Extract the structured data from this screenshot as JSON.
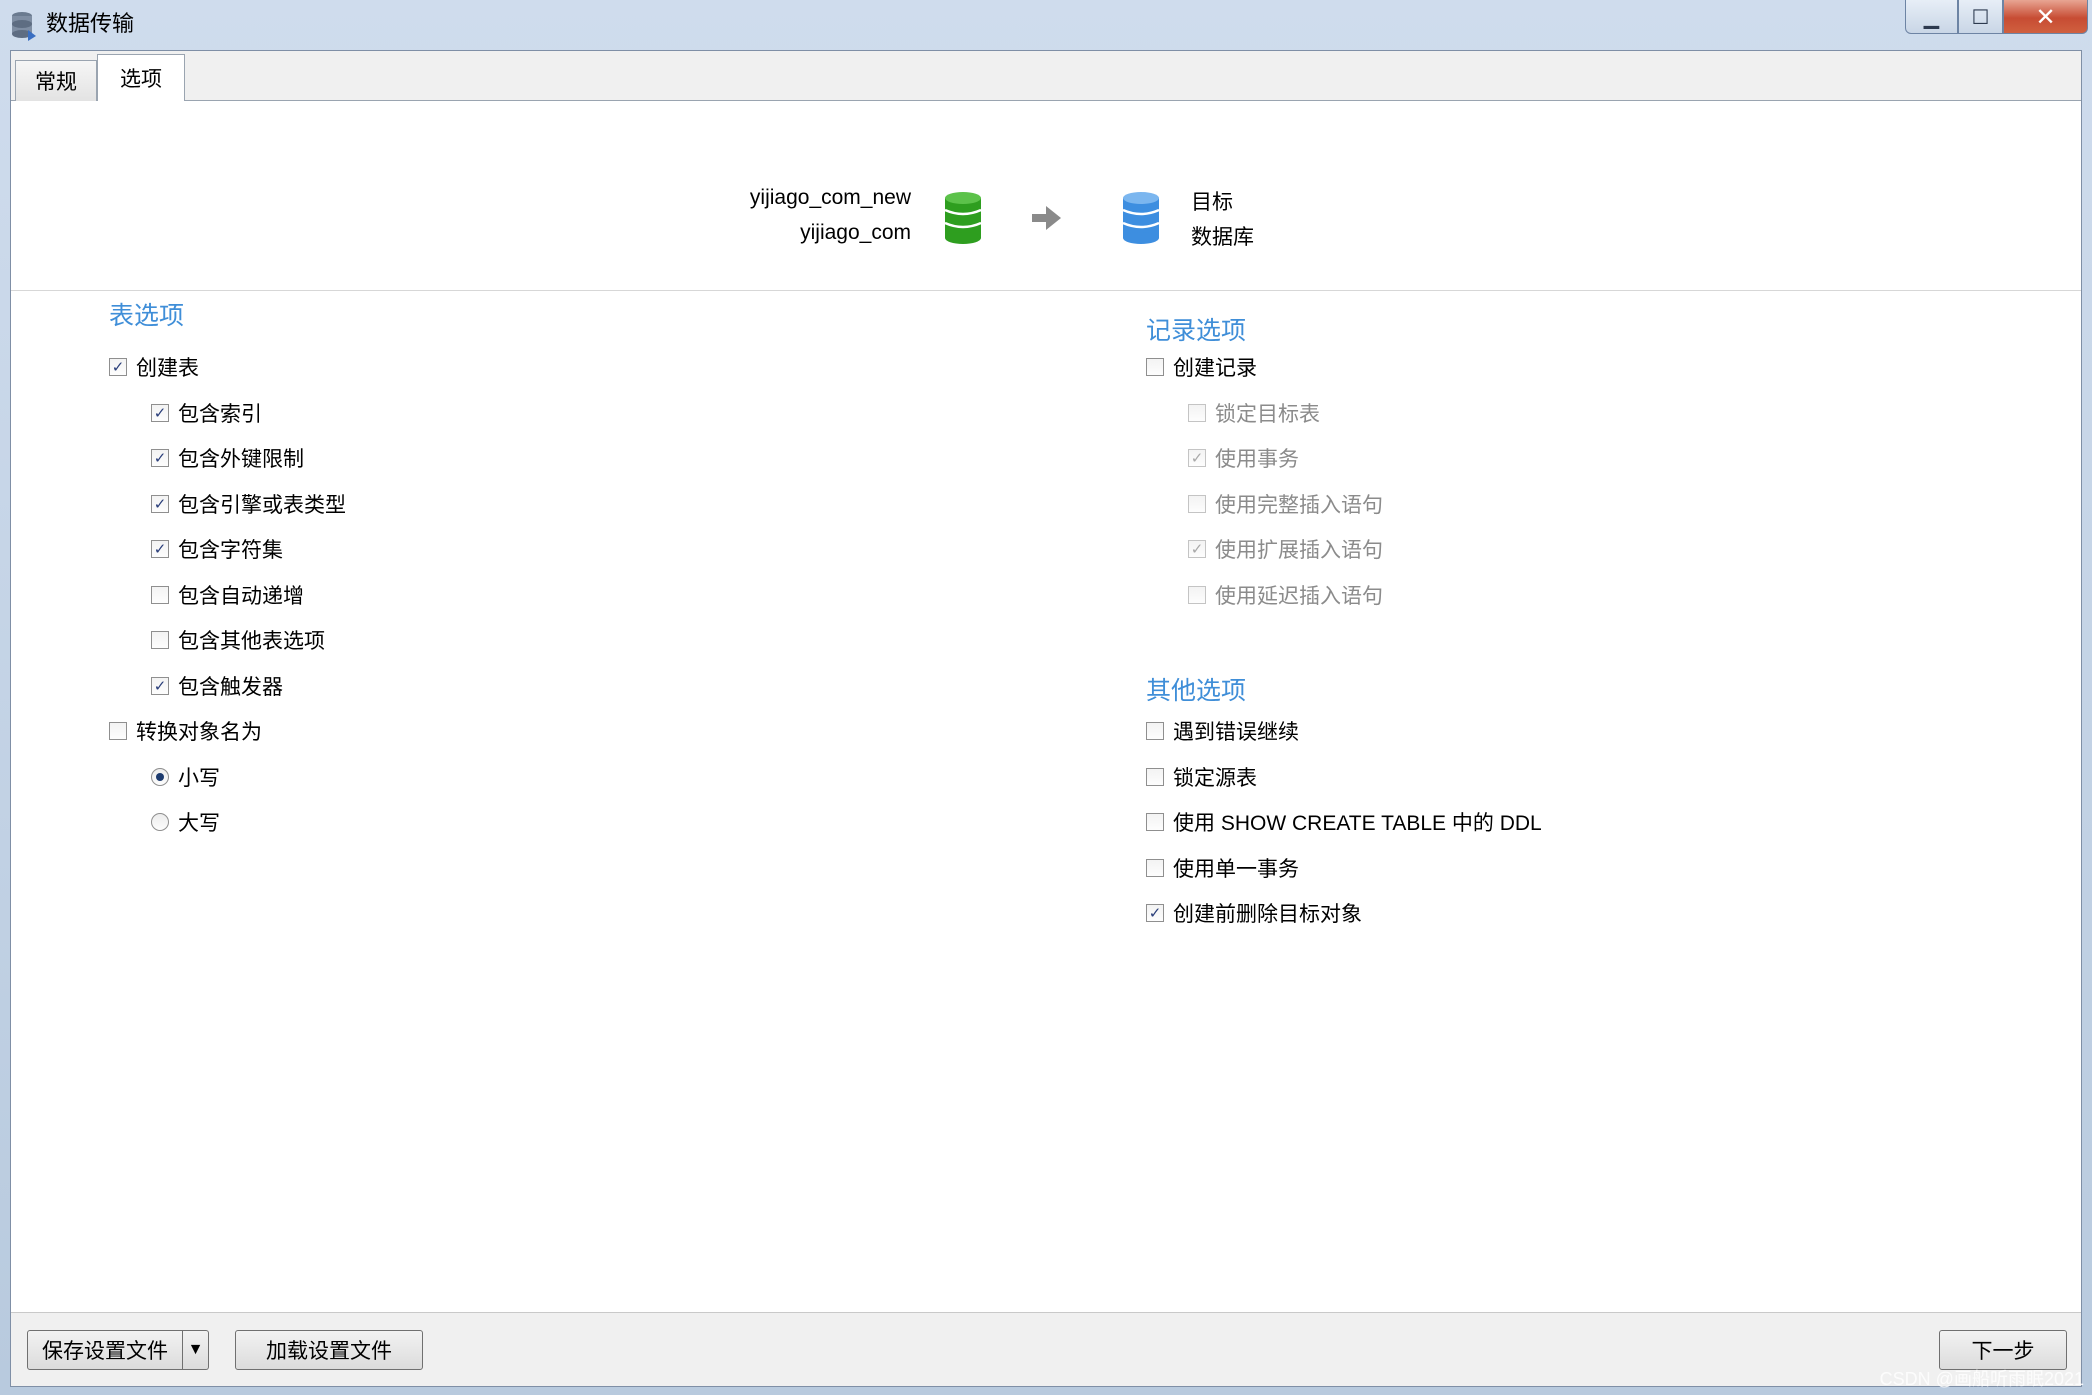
{
  "window": {
    "title": "数据传输"
  },
  "tabs": [
    {
      "label": "常规"
    },
    {
      "label": "选项"
    }
  ],
  "header": {
    "source_lines": [
      "yijiago_com_new",
      "yijiago_com"
    ],
    "target_lines": [
      "目标",
      "数据库"
    ],
    "source_icon": "database-green-icon",
    "target_icon": "database-blue-icon",
    "source_color": "#2e9e1f",
    "target_color": "#3d8ee0"
  },
  "table_options": {
    "title": "表选项",
    "create_table": {
      "label": "创建表",
      "checked": true
    },
    "sub_items": [
      {
        "label": "包含索引",
        "checked": true
      },
      {
        "label": "包含外键限制",
        "checked": true
      },
      {
        "label": "包含引擎或表类型",
        "checked": true
      },
      {
        "label": "包含字符集",
        "checked": true
      },
      {
        "label": "包含自动递增",
        "checked": false
      },
      {
        "label": "包含其他表选项",
        "checked": false
      },
      {
        "label": "包含触发器",
        "checked": true
      }
    ],
    "convert_names": {
      "label": "转换对象名为",
      "checked": false
    },
    "case_options": [
      {
        "label": "小写",
        "selected": true
      },
      {
        "label": "大写",
        "selected": false
      }
    ]
  },
  "record_options": {
    "title": "记录选项",
    "create_records": {
      "label": "创建记录",
      "checked": false
    },
    "sub_items": [
      {
        "label": "锁定目标表",
        "checked": false
      },
      {
        "label": "使用事务",
        "checked": true
      },
      {
        "label": "使用完整插入语句",
        "checked": false
      },
      {
        "label": "使用扩展插入语句",
        "checked": true
      },
      {
        "label": "使用延迟插入语句",
        "checked": false
      }
    ]
  },
  "other_options": {
    "title": "其他选项",
    "items": [
      {
        "label": "遇到错误继续",
        "checked": false
      },
      {
        "label": "锁定源表",
        "checked": false
      },
      {
        "label": "使用 SHOW CREATE TABLE 中的 DDL",
        "checked": false
      },
      {
        "label": "使用单一事务",
        "checked": false
      },
      {
        "label": "创建前删除目标对象",
        "checked": true
      }
    ]
  },
  "footer": {
    "save_label": "保存设置文件",
    "load_label": "加载设置文件",
    "next_label": "下一步"
  },
  "watermark": "CSDN @画船听雨眠2021",
  "accent_color": "#3f8ed8"
}
